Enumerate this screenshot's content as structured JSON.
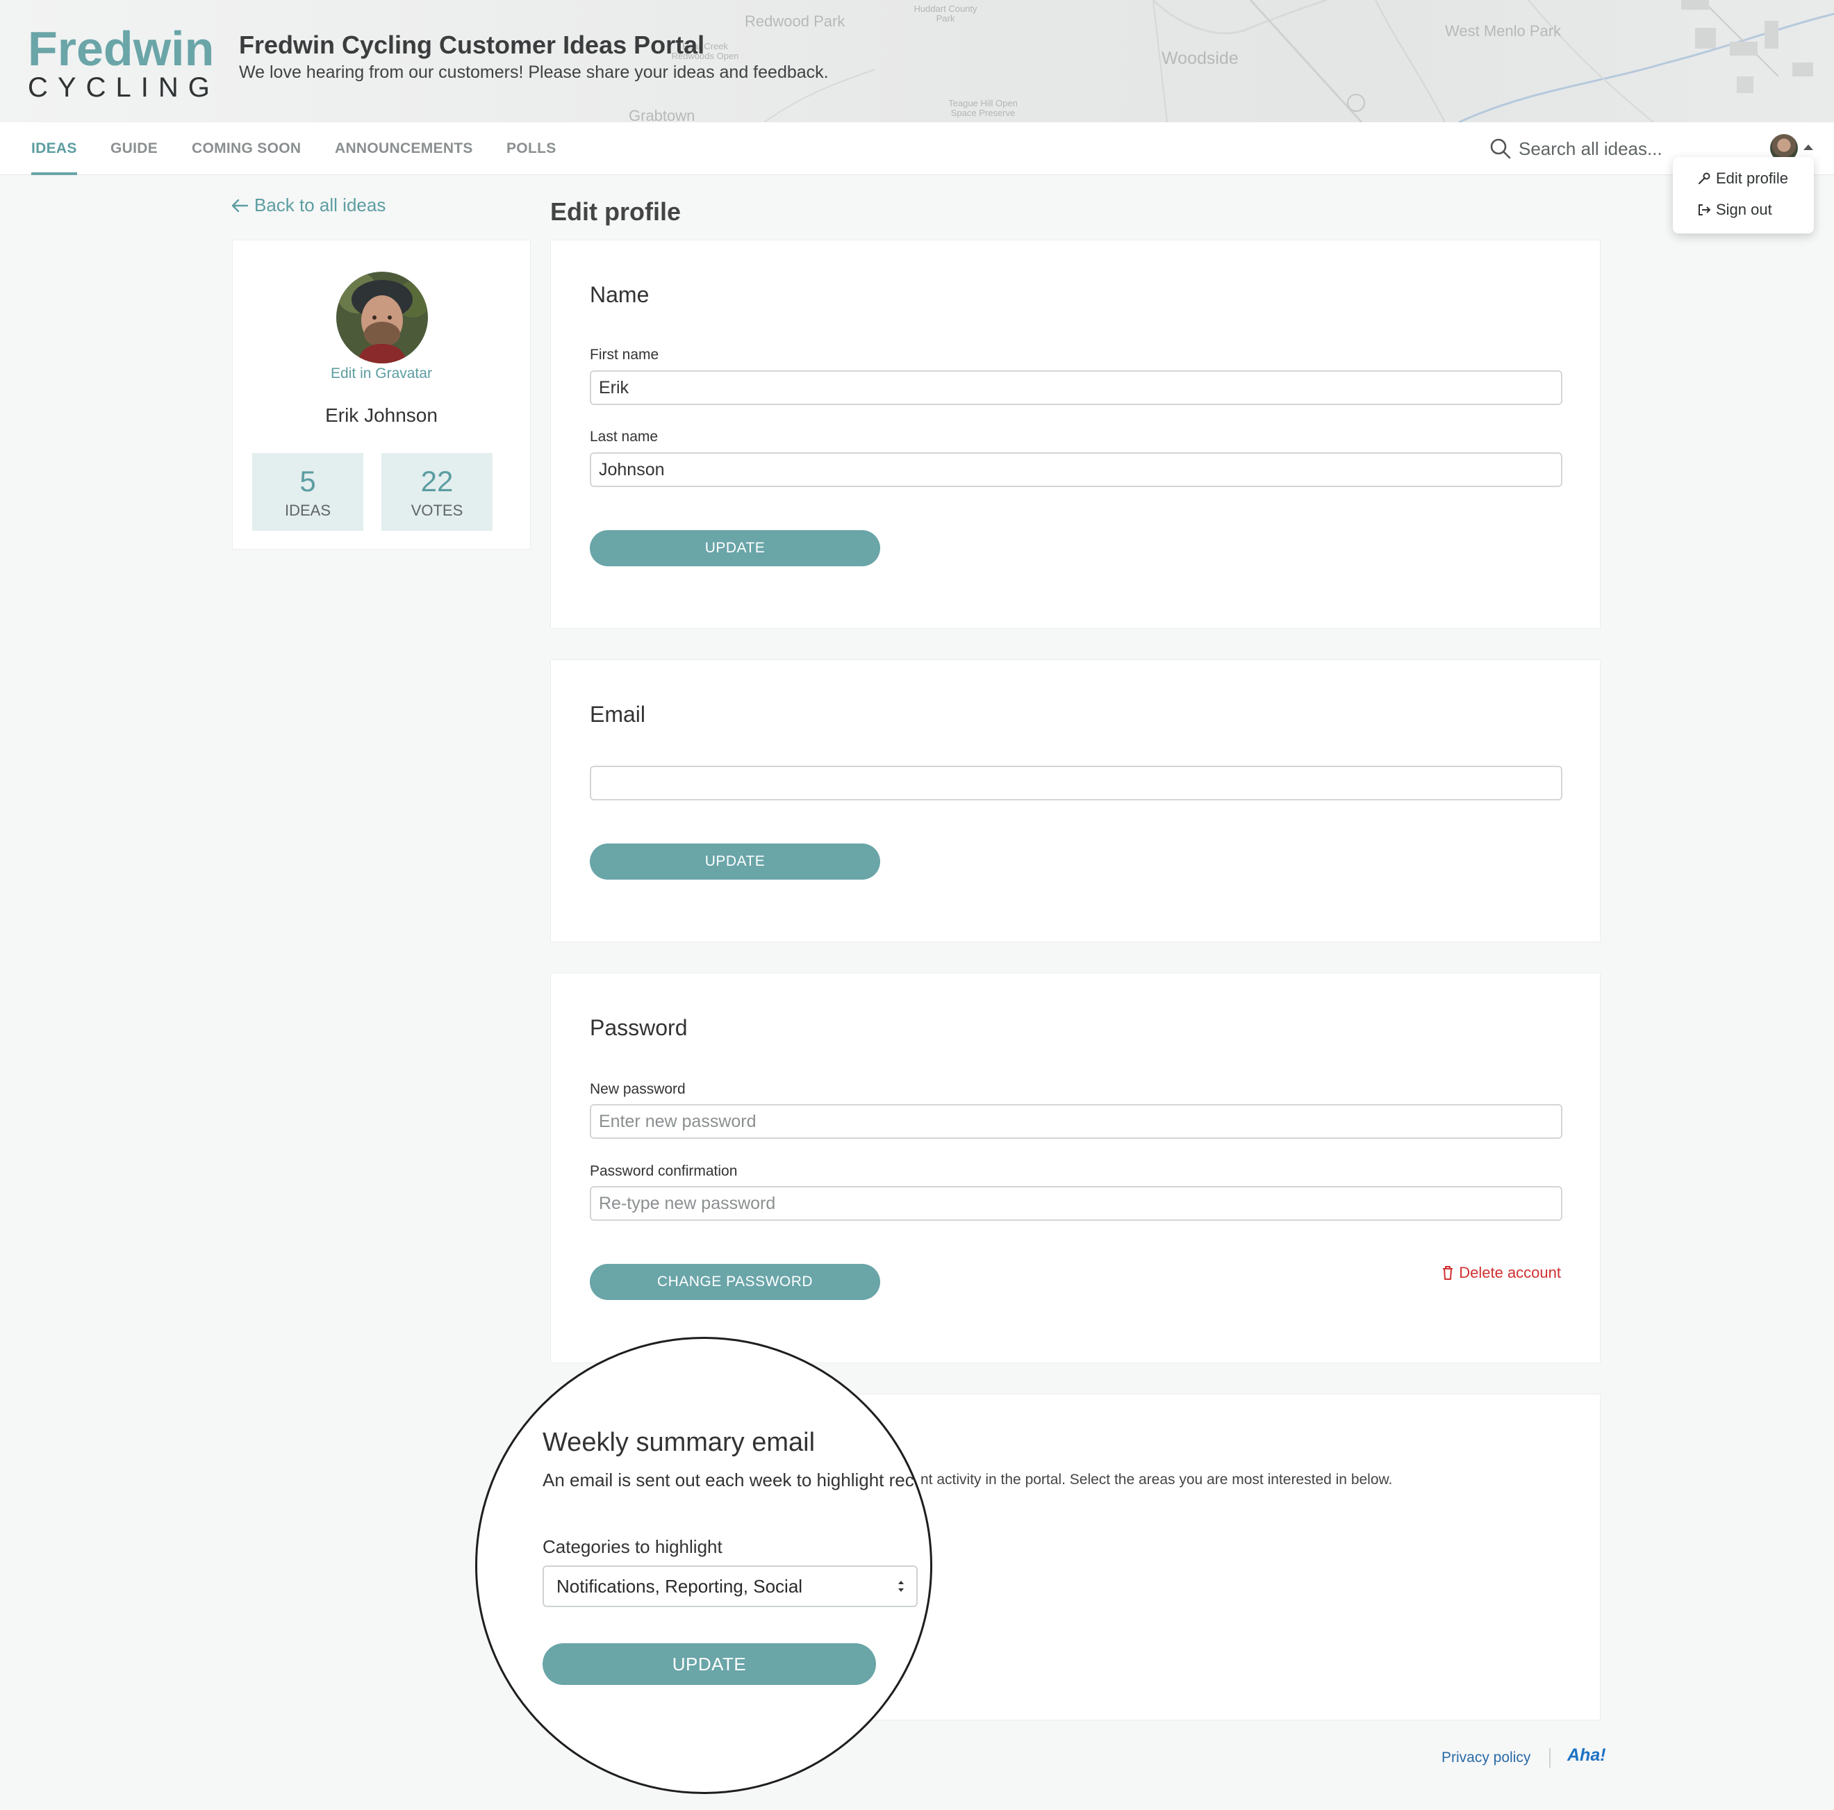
{
  "header": {
    "logo_word": "Fredwin",
    "logo_sub": "CYCLING",
    "title": "Fredwin Cycling Customer Ideas Portal",
    "subtitle": "We love hearing from our customers! Please share your ideas and feedback.",
    "map_labels": {
      "redwood_park": "Redwood Park",
      "huddart": "Huddart County\nPark",
      "bear_creek": "Bear Creek\nRedwoods Open",
      "woodside": "Woodside",
      "west_menlo": "West Menlo Park",
      "teague": "Teague Hill Open\nSpace Preserve",
      "grabtown": "Grabtown"
    }
  },
  "nav": {
    "tabs": [
      {
        "label": "IDEAS",
        "active": true
      },
      {
        "label": "GUIDE",
        "active": false
      },
      {
        "label": "COMING SOON",
        "active": false
      },
      {
        "label": "ANNOUNCEMENTS",
        "active": false
      },
      {
        "label": "POLLS",
        "active": false
      }
    ],
    "search_placeholder": "Search all ideas..."
  },
  "user_menu": {
    "edit_profile": "Edit profile",
    "sign_out": "Sign out"
  },
  "sidebar": {
    "back_link": "Back to all ideas",
    "gravatar_link": "Edit in Gravatar",
    "name": "Erik Johnson",
    "stats": [
      {
        "value": "5",
        "label": "IDEAS"
      },
      {
        "value": "22",
        "label": "VOTES"
      }
    ]
  },
  "main": {
    "page_title": "Edit profile",
    "name_panel": {
      "title": "Name",
      "first_name_label": "First name",
      "first_name_value": "Erik",
      "last_name_label": "Last name",
      "last_name_value": "Johnson",
      "button": "UPDATE"
    },
    "email_panel": {
      "title": "Email",
      "email_value": "",
      "button": "UPDATE"
    },
    "password_panel": {
      "title": "Password",
      "new_label": "New password",
      "new_placeholder": "Enter new password",
      "confirm_label": "Password confirmation",
      "confirm_placeholder": "Re-type new password",
      "button": "CHANGE PASSWORD",
      "delete_link": "Delete account"
    },
    "weekly_panel": {
      "title": "Weekly summary email",
      "desc_part1": "An email is sent out each week to highlight rec",
      "desc_part2": "nt activity in the portal. Select the areas you are most interested in below.",
      "categories_label": "Categories to highlight",
      "categories_value": "Notifications, Reporting, Social",
      "button": "UPDATE"
    }
  },
  "footer": {
    "privacy": "Privacy policy",
    "brand": "Aha!"
  },
  "colors": {
    "accent": "#6aa5a8",
    "link": "#5c9da1",
    "danger": "#d03030",
    "footer_link": "#2a6aa8"
  }
}
